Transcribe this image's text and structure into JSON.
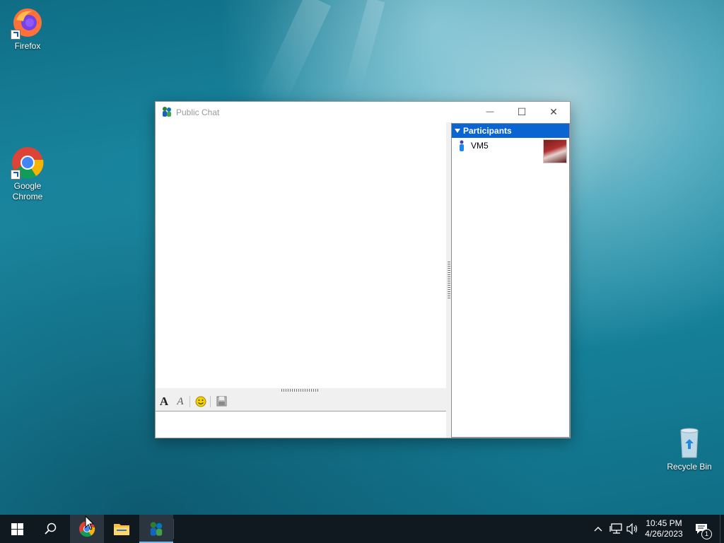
{
  "desktop": {
    "icons": [
      {
        "label": "Firefox",
        "icon": "firefox-icon"
      },
      {
        "label": "Google Chrome",
        "icon": "chrome-icon"
      },
      {
        "label": "Recycle Bin",
        "icon": "recycle-bin-icon"
      }
    ]
  },
  "window": {
    "title": "Public Chat",
    "controls": {
      "minimize": "—",
      "maximize": "☐",
      "close": "✕"
    },
    "toolbar": {
      "font": "A",
      "font_color": "A",
      "emoji": "☺",
      "save": "save-icon"
    },
    "participants": {
      "header": "Participants",
      "users": [
        {
          "name": "VM5"
        }
      ]
    }
  },
  "taskbar": {
    "clock": {
      "time": "10:45 PM",
      "date": "4/26/2023"
    },
    "notification_count": "1"
  }
}
